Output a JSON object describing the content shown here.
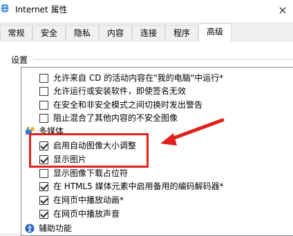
{
  "window": {
    "title": "Internet 属性",
    "close_glyph": "×"
  },
  "tabs": [
    {
      "label": "常规",
      "active": false
    },
    {
      "label": "安全",
      "active": false
    },
    {
      "label": "隐私",
      "active": false
    },
    {
      "label": "内容",
      "active": false
    },
    {
      "label": "连接",
      "active": false
    },
    {
      "label": "程序",
      "active": false
    },
    {
      "label": "高级",
      "active": true
    }
  ],
  "settings": {
    "group_label": "设置",
    "items": [
      {
        "label": "允许来自 CD 的活动内容在\"我的电脑\"中运行*",
        "checked": false
      },
      {
        "label": "允许运行或安装软件，即使签名无效",
        "checked": false
      },
      {
        "label": "在安全和非安全模式之间切换时发出警告",
        "checked": false
      },
      {
        "label": "阻止混合了其他内容的不安全图像",
        "checked": false
      }
    ],
    "multimedia": {
      "label": "多媒体",
      "items": [
        {
          "label": "启用自动图像大小调整",
          "checked": true
        },
        {
          "label": "显示图片",
          "checked": true
        },
        {
          "label": "显示图像下载占位符",
          "checked": false
        },
        {
          "label": "在 HTML5 媒体元素中启用备用的编码解码器*",
          "checked": true
        },
        {
          "label": "在网页中播放动画*",
          "checked": true
        },
        {
          "label": "在网页中播放声音",
          "checked": true
        }
      ]
    },
    "accessibility": {
      "label": "辅助功能"
    }
  },
  "annotation": {
    "color": "#e0201b"
  }
}
